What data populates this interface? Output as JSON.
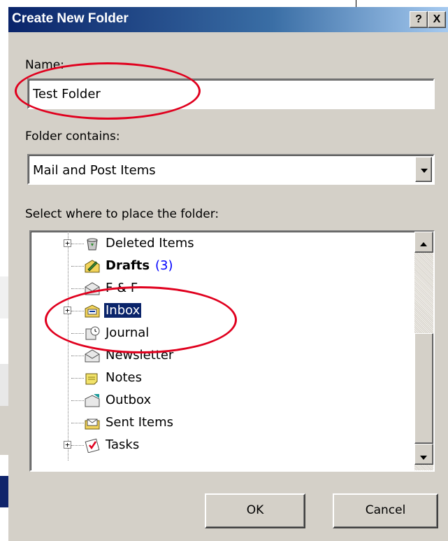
{
  "dialog": {
    "title": "Create New Folder",
    "help_button": "?",
    "close_button": "X"
  },
  "name_field": {
    "label": "Name:",
    "value": "Test Folder"
  },
  "folder_contains": {
    "label": "Folder contains:",
    "selected": "Mail and Post Items"
  },
  "location": {
    "label": "Select where to place the folder:",
    "tree_items": [
      {
        "label": "Deleted Items",
        "icon": "deleted-items-icon",
        "expandable": true
      },
      {
        "label": "Drafts",
        "count": "(3)",
        "bold": true,
        "icon": "drafts-icon",
        "expandable": false
      },
      {
        "label": "F & F",
        "icon": "folder-icon",
        "expandable": false
      },
      {
        "label": "Inbox",
        "icon": "inbox-icon",
        "expandable": true,
        "selected": true
      },
      {
        "label": "Journal",
        "icon": "journal-icon",
        "expandable": false
      },
      {
        "label": "Newsletter",
        "icon": "folder-icon",
        "expandable": false
      },
      {
        "label": "Notes",
        "icon": "notes-icon",
        "expandable": false
      },
      {
        "label": "Outbox",
        "icon": "outbox-icon",
        "expandable": false
      },
      {
        "label": "Sent Items",
        "icon": "sent-items-icon",
        "expandable": false
      },
      {
        "label": "Tasks",
        "icon": "tasks-icon",
        "expandable": true
      }
    ],
    "expander_symbol": "+"
  },
  "buttons": {
    "ok": "OK",
    "cancel": "Cancel"
  },
  "colors": {
    "title_bar": "#0a246a",
    "selection": "#0a246a",
    "annotation": "#e0001e",
    "count": "#0000ff"
  }
}
